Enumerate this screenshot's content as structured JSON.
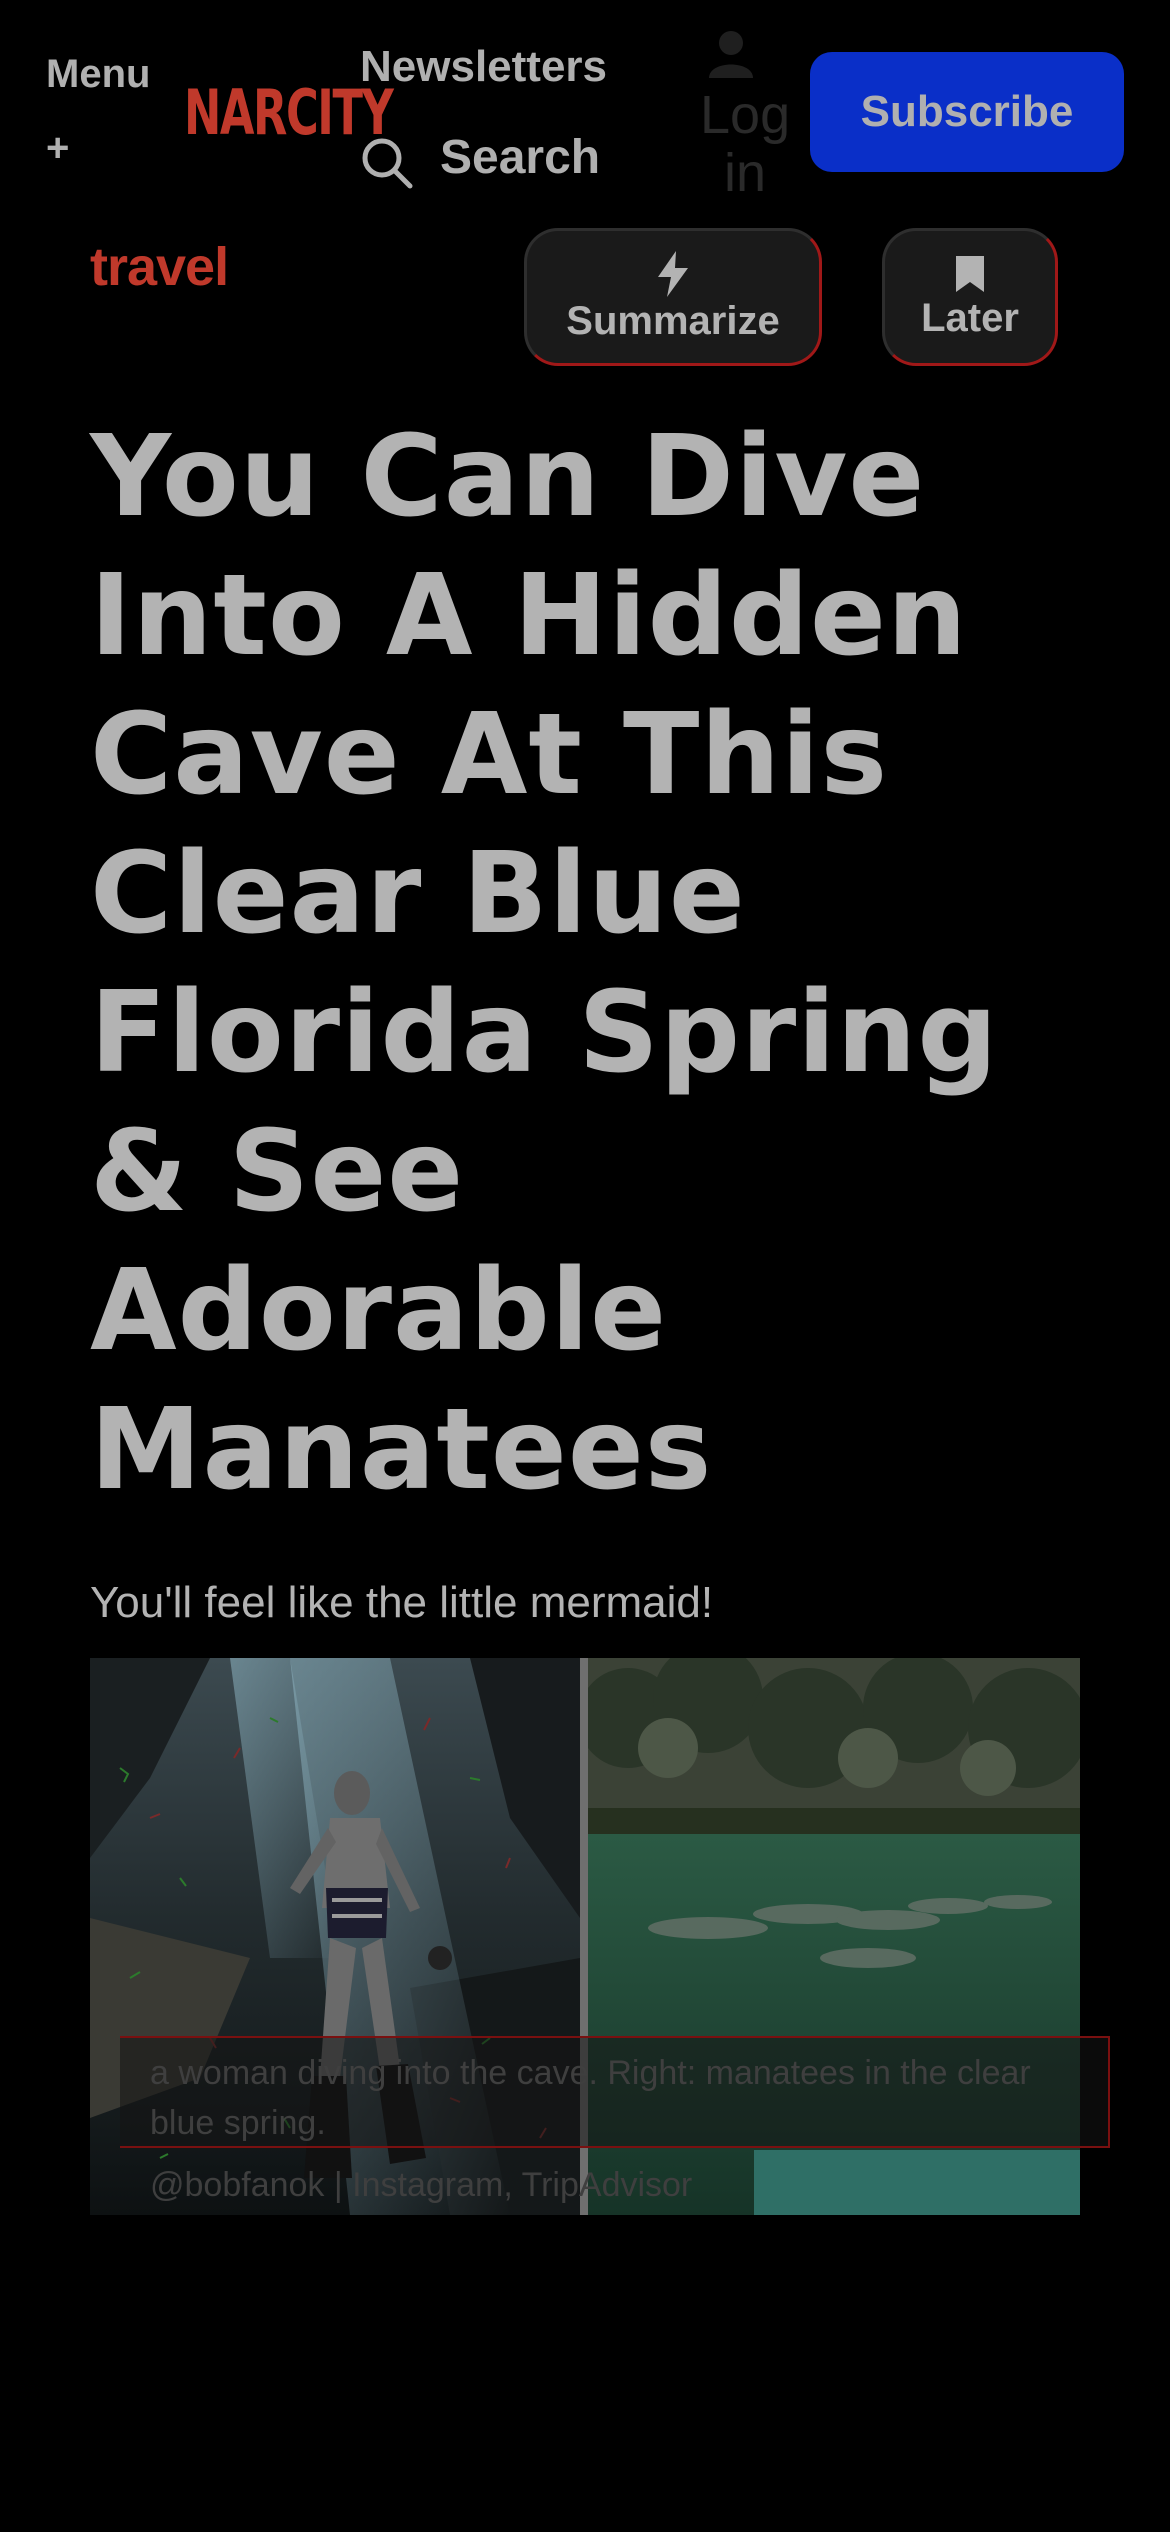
{
  "header": {
    "menu_label": "Menu",
    "menu_plus": "+",
    "logo_text": "NARCITY",
    "newsletters_label": "Newsletters",
    "search_label": "Search",
    "login_label": "Log in",
    "subscribe_label": "Subscribe"
  },
  "article": {
    "category": "travel",
    "summarize_label": "Summarize",
    "later_label": "Later",
    "title_lines": [
      "You Can Dive",
      "Into A Hidden",
      "Cave At This",
      "Clear Blue",
      "Florida Spring",
      "& See",
      "Adorable",
      "Manatees"
    ],
    "dek": "You'll feel like the little mermaid!",
    "image_caption": "a woman diving into the cave. Right: manatees in the clear blue spring.",
    "image_credit": "@bobfanok | Instagram, TripAdvisor"
  },
  "colors": {
    "background": "#000000",
    "brand_red": "#c0392b",
    "subscribe_blue": "#0a2fc8",
    "text_gray": "#b3b3b3"
  },
  "icons": [
    "search-icon",
    "user-icon",
    "lightning-icon",
    "bookmark-icon"
  ]
}
